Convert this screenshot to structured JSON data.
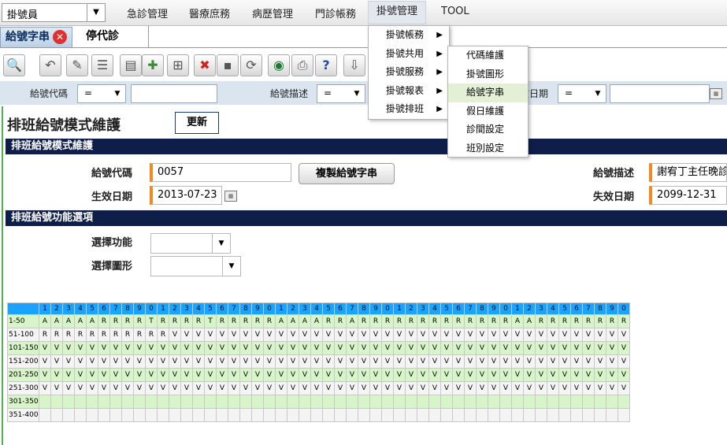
{
  "menubar": {
    "role_value": "掛號員",
    "items": [
      "急診管理",
      "醫療庶務",
      "病歷管理",
      "門診帳務",
      "掛號管理",
      "TOOL"
    ]
  },
  "tabs": [
    {
      "label": "給號字串"
    },
    {
      "label": "停代診"
    }
  ],
  "filter": {
    "fields": [
      {
        "label": "給號代碼",
        "op": "="
      },
      {
        "label": "給號描述",
        "op": "="
      },
      {
        "label": "生效日期",
        "op": "="
      }
    ]
  },
  "page": {
    "title": "排班給號模式維護",
    "refresh_label": "更新"
  },
  "section1": {
    "title": "排班給號模式維護",
    "code_label": "給號代碼",
    "code_value": "0057",
    "copy_button": "複製給號字串",
    "desc_label": "給號描述",
    "desc_value": "謝宥丁主任晚診",
    "start_label": "生效日期",
    "start_value": "2013-07-23",
    "end_label": "失效日期",
    "end_value": "2099-12-31"
  },
  "section2": {
    "title": "排班給號功能選項",
    "function_label": "選擇功能",
    "shape_label": "選擇圖形"
  },
  "grid": {
    "header": [
      "1",
      "2",
      "3",
      "4",
      "5",
      "6",
      "7",
      "8",
      "9",
      "0",
      "1",
      "2",
      "3",
      "4",
      "5",
      "6",
      "7",
      "8",
      "9",
      "0",
      "1",
      "2",
      "3",
      "4",
      "5",
      "6",
      "7",
      "8",
      "9",
      "0",
      "1",
      "2",
      "3",
      "4",
      "5",
      "6",
      "7",
      "8",
      "9",
      "0",
      "1",
      "2",
      "3",
      "4",
      "5",
      "6",
      "7",
      "8",
      "9",
      "0"
    ],
    "rows": [
      {
        "label": "1-50",
        "cells": "AAAAARRRRTRRRRTRRRRRAAAARRARRRRRRRRRRRRRAARRRRRRRR"
      },
      {
        "label": "51-100",
        "cells": "RRRRRRRRRRRVVVVVVVVVVVVVVVVVVVVVVVVVVVVVVVVVVVVVVV"
      },
      {
        "label": "101-150",
        "cells": "VVVVVVVVVVVVVVVVVVVVVVVVVVVVVVVVVVVVVVVVVVVVVVVVVV"
      },
      {
        "label": "151-200",
        "cells": "VVVVVVVVVVVVVVVVVVVVVVVVVVVVVVVVVVVVVVVVVVVVVVVVVV"
      },
      {
        "label": "201-250",
        "cells": "VVVVVVVVVVVVVVVVVVVVVVVVVVVVVVVVVVVVVVVVVVVVVVVVVV"
      },
      {
        "label": "251-300",
        "cells": "VVVVVVVVVVVVVVVVVVVVVVVVVVVVVVVVVVVVVVVVVVVVVVVVVV"
      },
      {
        "label": "301-350",
        "cells": ""
      },
      {
        "label": "351-400",
        "cells": ""
      }
    ]
  },
  "dropdown_menu": {
    "items": [
      {
        "label": "掛號帳務"
      },
      {
        "label": "掛號共用"
      },
      {
        "label": "掛號服務"
      },
      {
        "label": "掛號報表"
      },
      {
        "label": "掛號排班"
      }
    ]
  },
  "submenu": {
    "items": [
      {
        "label": "代碼維護"
      },
      {
        "label": "掛號圖形"
      },
      {
        "label": "給號字串"
      },
      {
        "label": "假日維護"
      },
      {
        "label": "診間設定"
      },
      {
        "label": "班別設定"
      }
    ]
  }
}
